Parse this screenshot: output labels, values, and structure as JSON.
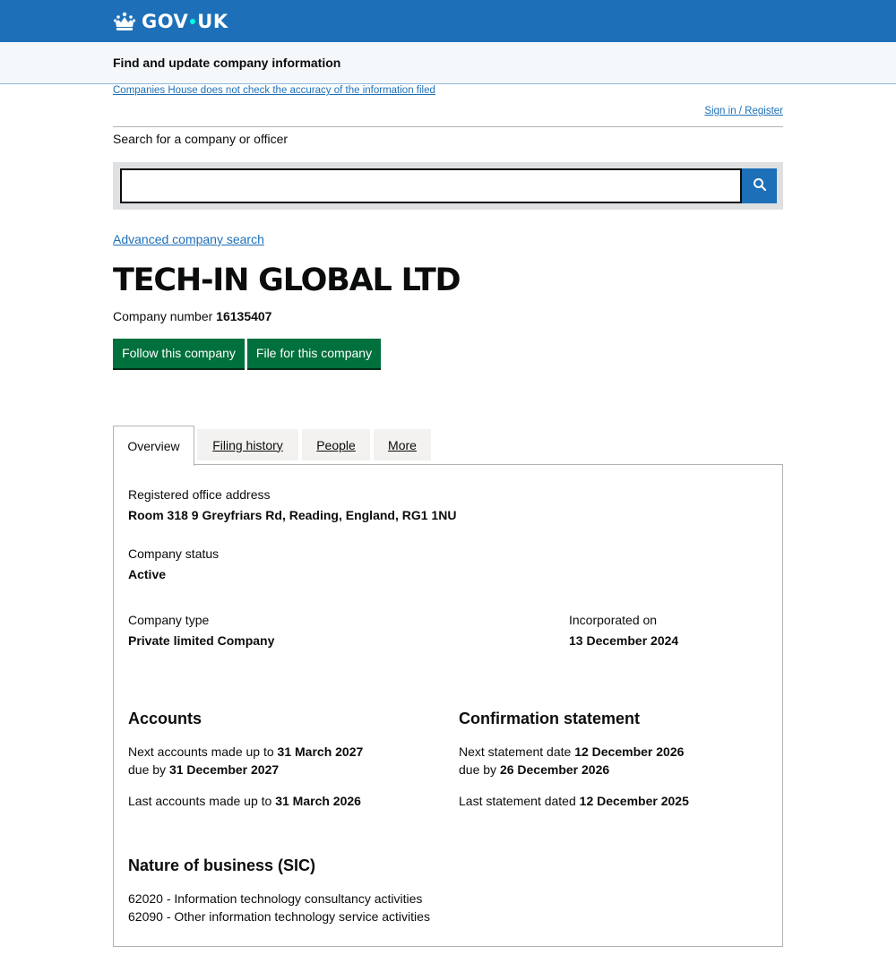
{
  "header": {
    "logo_text_left": "GOV",
    "logo_text_right": "UK",
    "service_name": "Find and update company information"
  },
  "notices": {
    "accuracy_link": "Companies House does not check the accuracy of the information filed",
    "signin_link": "Sign in / Register"
  },
  "search": {
    "label": "Search for a company or officer",
    "value": "",
    "placeholder": "",
    "advanced_link": "Advanced company search"
  },
  "company": {
    "name": "TECH-IN GLOBAL LTD",
    "number_label": "Company number",
    "number": "16135407"
  },
  "actions": {
    "follow_label": "Follow this company",
    "file_label": "File for this company"
  },
  "tabs": [
    {
      "label": "Overview",
      "active": true
    },
    {
      "label": "Filing history",
      "active": false
    },
    {
      "label": "People",
      "active": false
    },
    {
      "label": "More",
      "active": false
    }
  ],
  "overview": {
    "registered_office_label": "Registered office address",
    "registered_office_value": "Room 318 9 Greyfriars Rd, Reading, England, RG1 1NU",
    "status_label": "Company status",
    "status_value": "Active",
    "type_label": "Company type",
    "type_value": "Private limited Company",
    "incorporated_label": "Incorporated on",
    "incorporated_value": "13 December 2024"
  },
  "accounts": {
    "heading": "Accounts",
    "next_prefix": "Next accounts made up to",
    "next_date": "31 March 2027",
    "due_prefix": "due by",
    "due_date": "31 December 2027",
    "last_prefix": "Last accounts made up to",
    "last_date": "31 March 2026"
  },
  "confirmation": {
    "heading": "Confirmation statement",
    "next_prefix": "Next statement date",
    "next_date": "12 December 2026",
    "due_prefix": "due by",
    "due_date": "26 December 2026",
    "last_prefix": "Last statement dated",
    "last_date": "12 December 2025"
  },
  "sic": {
    "heading": "Nature of business (SIC)",
    "items": [
      "62020 - Information technology consultancy activities",
      "62090 - Other information technology service activities"
    ]
  },
  "colors": {
    "header_blue": "#1d70b8",
    "button_green": "#00703c",
    "link_blue": "#1d70b8",
    "logo_dot": "#00ffe0"
  },
  "icons": {
    "logo": "crown-icon",
    "search": "search-icon"
  }
}
